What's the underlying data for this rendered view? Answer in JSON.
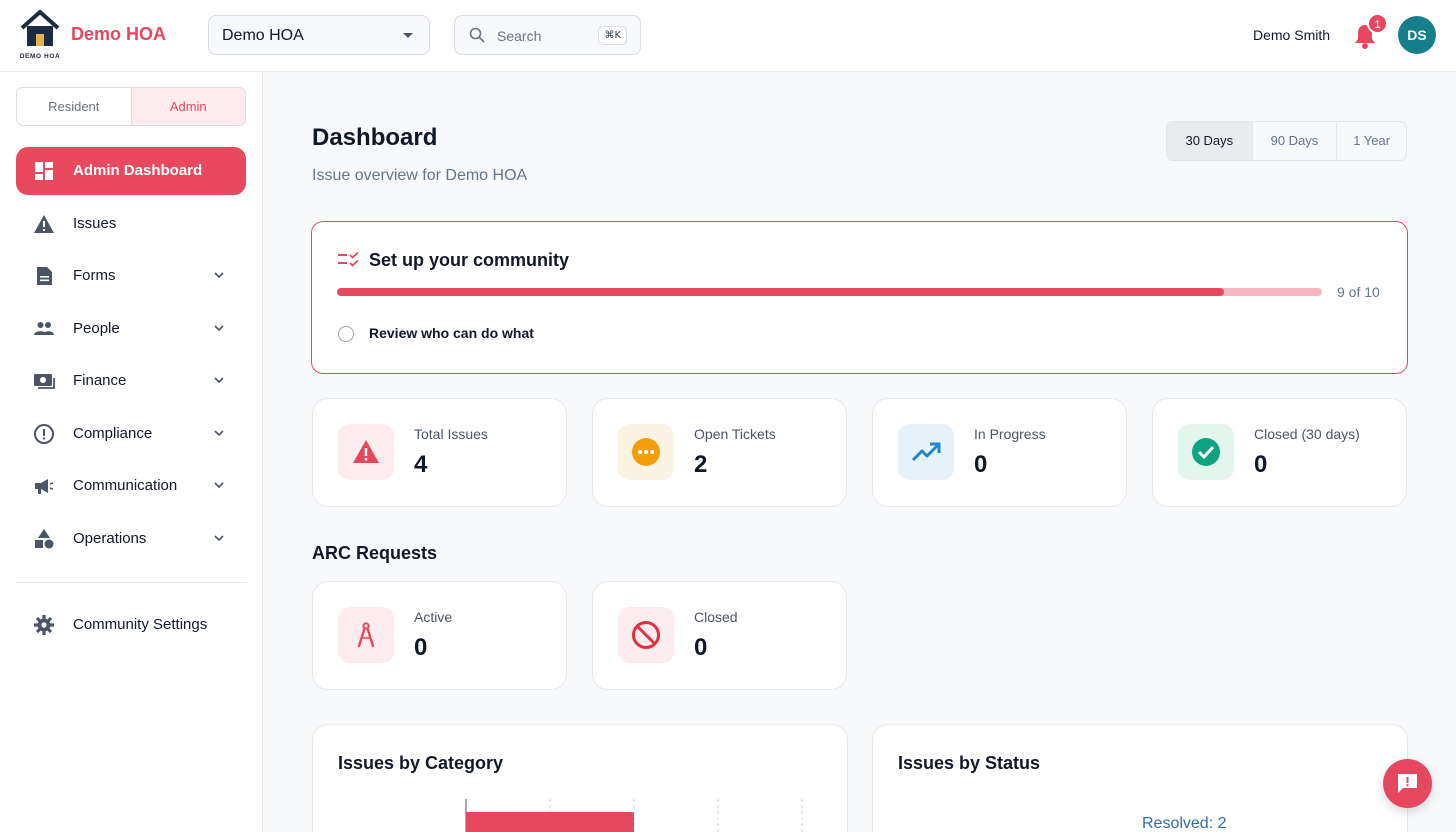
{
  "header": {
    "logo_text": "DEMO HOA",
    "brand": "Demo HOA",
    "hoa_select_value": "Demo HOA",
    "search_placeholder": "Search",
    "search_shortcut": "⌘K",
    "user_name": "Demo Smith",
    "notification_count": "1",
    "avatar_initials": "DS"
  },
  "sidebar": {
    "role_tabs": [
      "Resident",
      "Admin"
    ],
    "active_role": "Admin",
    "items": [
      {
        "label": "Admin Dashboard",
        "icon": "dashboard-icon",
        "active": true
      },
      {
        "label": "Issues",
        "icon": "warning-icon"
      },
      {
        "label": "Forms",
        "icon": "document-icon",
        "expandable": true
      },
      {
        "label": "People",
        "icon": "people-icon",
        "expandable": true
      },
      {
        "label": "Finance",
        "icon": "money-icon",
        "expandable": true
      },
      {
        "label": "Compliance",
        "icon": "alert-circle-icon",
        "expandable": true
      },
      {
        "label": "Communication",
        "icon": "megaphone-icon",
        "expandable": true
      },
      {
        "label": "Operations",
        "icon": "shapes-icon",
        "expandable": true
      }
    ],
    "settings_label": "Community Settings"
  },
  "main": {
    "title": "Dashboard",
    "subtitle": "Issue overview for Demo HOA",
    "ranges": [
      "30 Days",
      "90 Days",
      "1 Year"
    ],
    "active_range": "30 Days",
    "setup": {
      "title": "Set up your community",
      "completed": 9,
      "total": 10,
      "progress_text": "9 of 10",
      "pending_task": "Review who can do what"
    },
    "stats": [
      {
        "label": "Total Issues",
        "value": "4"
      },
      {
        "label": "Open Tickets",
        "value": "2"
      },
      {
        "label": "In Progress",
        "value": "0"
      },
      {
        "label": "Closed (30 days)",
        "value": "0"
      }
    ],
    "arc_title": "ARC Requests",
    "arc_stats": [
      {
        "label": "Active",
        "value": "0"
      },
      {
        "label": "Closed",
        "value": "0"
      }
    ],
    "charts": {
      "category_title": "Issues by Category",
      "status_title": "Issues by Status",
      "status_label": "Resolved: 2"
    }
  },
  "colors": {
    "accent": "#e5485e",
    "teal": "#157f8c",
    "orange": "#f59e0b",
    "blue": "#1e88c8",
    "green": "#10a37f"
  }
}
